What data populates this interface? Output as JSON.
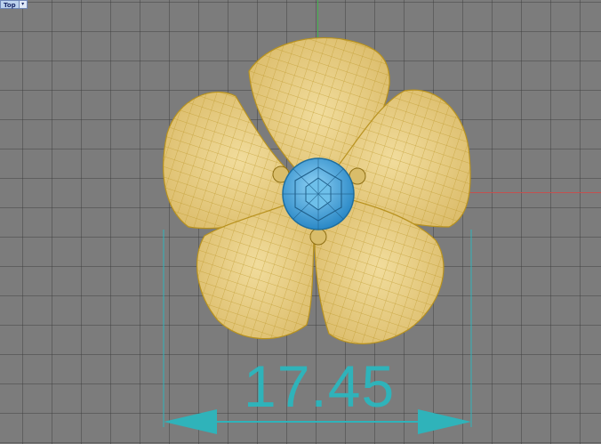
{
  "viewport": {
    "view_name": "Top",
    "view_menu_icon": "chevron-down-icon",
    "dropdown_glyph": "▾"
  },
  "model": {
    "petal_color": "#e7cc83",
    "wire_color": "#b8921f",
    "gem_color": "#4aa3d9",
    "prong_color": "#d9bd6a"
  },
  "dimension": {
    "value_text": "17.45",
    "color": "#2fb3ba"
  },
  "colors": {
    "background": "#7c7c7c",
    "grid_line": "#555555",
    "y_axis": "#3fae4a",
    "x_axis": "#c2504f"
  }
}
